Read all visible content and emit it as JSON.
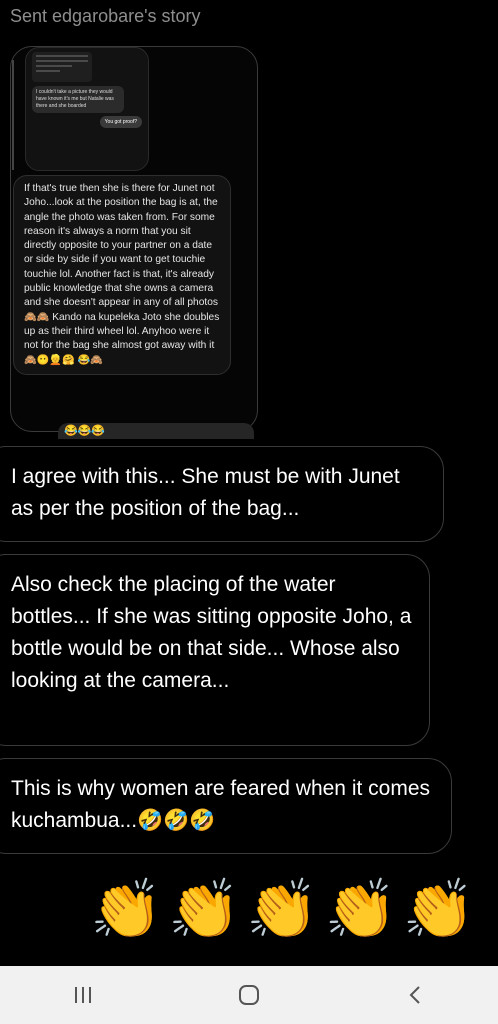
{
  "header": {
    "title": "Sent edgarobare's story"
  },
  "story": {
    "thumb_message": "I couldn't take a picture they would have known it's me but Natalie was there and she boarded",
    "thumb_reply": "You got proof?",
    "message": "If that's true then she is there for Junet not Joho...look at the position the bag is at, the angle the photo was taken from. For some reason it's always a norm that you sit directly opposite to your partner on a date or side by side if you want to get touchie touchie lol. Another fact is that, it's already public knowledge that she owns a camera and she doesn't appear in any of all photos 🙈🙈 Kando na kupeleka Joto she doubles up as their third wheel lol. Anyhoo were it not for the bag she almost got away with it 🙈😶👱🤗 😂🙈",
    "reaction_preview": "😂😂😂"
  },
  "messages": [
    {
      "text": "I agree with this... She must be with Junet as per the position of the bag..."
    },
    {
      "text": "Also check the placing of the water bottles... If she was sitting opposite Joho, a bottle would be on that side... Whose also looking at the camera..."
    },
    {
      "text": "This is why women are feared when it comes kuchambua...🤣🤣🤣"
    }
  ],
  "claps": "👏👏👏👏👏",
  "nav": {
    "recents_icon": "recent-apps-icon",
    "home_icon": "home-icon",
    "back_icon": "back-icon"
  }
}
